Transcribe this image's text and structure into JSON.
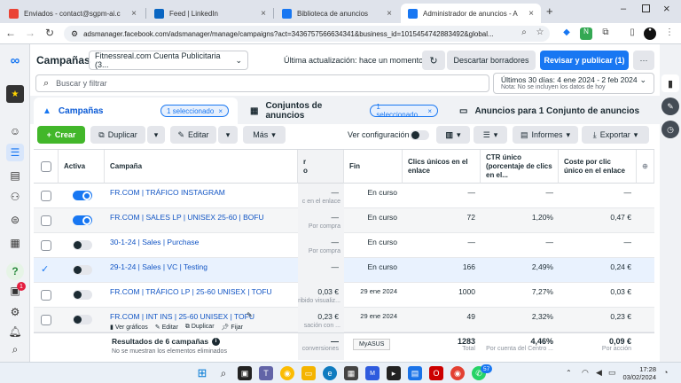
{
  "browser": {
    "tabs": [
      {
        "title": "Enviados - contact@sgpm-ai.c",
        "icon_color": "#ea4335",
        "icon": "M"
      },
      {
        "title": "Feed | LinkedIn",
        "icon_color": "#0a66c2",
        "icon": "in"
      },
      {
        "title": "Biblioteca de anuncios",
        "icon_color": "#1877f2",
        "icon": "∞"
      },
      {
        "title": "Administrador de anuncios - A",
        "icon_color": "#1877f2",
        "icon": "∞"
      }
    ],
    "url": "adsmanager.facebook.com/adsmanager/manage/campaigns?act=3436757566634341&business_id=1015454742883492&global..."
  },
  "header": {
    "title": "Campañas",
    "account": "Fitnessreal.com Cuenta Publicitaria (3...",
    "last_update": "Última actualización: hace un momento",
    "discard": "Descartar borradores",
    "publish": "Revisar y publicar (1)",
    "more": "···"
  },
  "search": {
    "placeholder": "Buscar y filtrar"
  },
  "date": {
    "range": "Últimos 30 días: 4 ene 2024 - 2 feb 2024",
    "note": "Nota: No se incluyen los datos de hoy"
  },
  "levels": {
    "campaigns": "Campañas",
    "campaigns_pill": "1 seleccionado",
    "adsets": "Conjuntos de anuncios",
    "adsets_pill": "1 seleccionado",
    "ads": "Anuncios para 1 Conjunto de anuncios"
  },
  "toolbar": {
    "create": "Crear",
    "duplicate": "Duplicar",
    "edit": "Editar",
    "more": "Más",
    "view_setup": "Ver configuración",
    "columns": "",
    "breakdown": "",
    "reports": "Informes",
    "export": "Exportar"
  },
  "columns": {
    "active": "Activa",
    "campaign": "Campaña",
    "partial": "r\no",
    "end": "Fin",
    "clicks": "Clics únicos en el enlace",
    "ctr": "CTR único (porcentaje de clics en el...",
    "cpc": "Coste por clic único en el enlace"
  },
  "rows": [
    {
      "name": "FR.COM | TRÁFICO INSTAGRAM",
      "active": true,
      "partial": "—",
      "partial_sub": "c en el enlace",
      "end": "En curso",
      "clicks": "—",
      "ctr": "—",
      "cpc": "—",
      "selected": false
    },
    {
      "name": "FR.COM | SALES LP | UNISEX 25-60 | BOFU",
      "active": true,
      "partial": "—",
      "partial_sub": "Por compra",
      "end": "En curso",
      "clicks": "72",
      "ctr": "1,20%",
      "cpc": "0,47 €",
      "selected": false
    },
    {
      "name": "30-1-24 | Sales | Purchase",
      "active": false,
      "partial": "—",
      "partial_sub": "Por compra",
      "end": "En curso",
      "clicks": "—",
      "ctr": "—",
      "cpc": "—",
      "selected": false
    },
    {
      "name": "29-1-24 | Sales | VC | Testing",
      "active": false,
      "partial": "—",
      "partial_sub": "",
      "end": "En curso",
      "clicks": "166",
      "ctr": "2,49%",
      "cpc": "0,24 €",
      "selected": true
    },
    {
      "name": "FR.COM | TRÁFICO LP | 25-60 UNISEX | TOFU",
      "active": false,
      "partial": "0,03 €",
      "partial_sub": "ribido visualiz...",
      "end": "29 ene 2024",
      "clicks": "1000",
      "ctr": "7,27%",
      "cpc": "0,03 €",
      "selected": false
    },
    {
      "name": "FR.COM | INT INS | 25-60 UNISEX | TOFU",
      "active": false,
      "partial": "0,23 €",
      "partial_sub": "sación con ...",
      "end": "29 ene 2024",
      "clicks": "49",
      "ctr": "2,32%",
      "cpc": "0,23 €",
      "selected": false
    }
  ],
  "row_actions": {
    "charts": "Ver gráficos",
    "edit": "Editar",
    "duplicate": "Duplicar",
    "pin": "Fijar"
  },
  "totals": {
    "label": "Resultados de 6 campañas",
    "note": "No se muestran los elementos eliminados",
    "partial": "—",
    "partial_sub": "conversiones",
    "tooltip": "MyASUS",
    "clicks": "1283",
    "clicks_sub": "Total",
    "ctr": "4,46%",
    "ctr_sub": "Por cuenta del Centro ...",
    "cpc": "0,09 €",
    "cpc_sub": "Por acción"
  },
  "taskbar": {
    "time": "17:28",
    "date": "03/02/2024",
    "badge": "57"
  },
  "rail_badge": "1"
}
